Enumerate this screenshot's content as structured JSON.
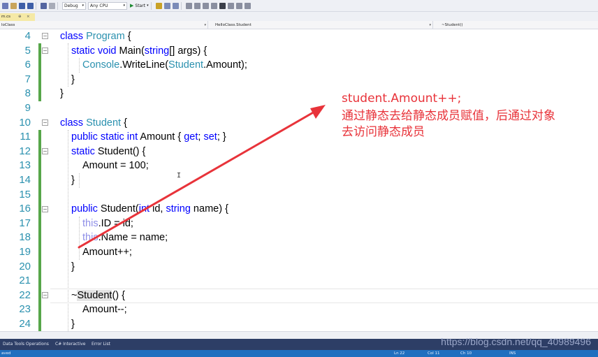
{
  "toolbar": {
    "config": "Debug",
    "platform": "Any CPU",
    "start": "Start"
  },
  "tab": {
    "label": "m.cs",
    "pin": "⊕",
    "close": "×"
  },
  "navbar": {
    "project": "loClass",
    "type": "HelloClass.Student",
    "member": "~Student()"
  },
  "editor": {
    "line_numbers": [
      "4",
      "5",
      "6",
      "7",
      "8",
      "9",
      "10",
      "11",
      "12",
      "13",
      "14",
      "15",
      "16",
      "17",
      "18",
      "19",
      "20",
      "21",
      "22",
      "23",
      "24"
    ]
  },
  "annotation": {
    "line1": "student.Amount++;",
    "line2": "通过静态去给静态成员赋值，后通过对象",
    "line3": "去访问静态成员",
    "color": "#e8333a"
  },
  "bottom_tabs": [
    "Data Tools Operations",
    "C# Interactive",
    "Error List"
  ],
  "watermark": "https://blog.csdn.net/qq_40989496",
  "status": {
    "left": "aved",
    "ln": "Ln 22",
    "col": "Col 11",
    "ch": "Ch 10",
    "mode": "INS"
  }
}
